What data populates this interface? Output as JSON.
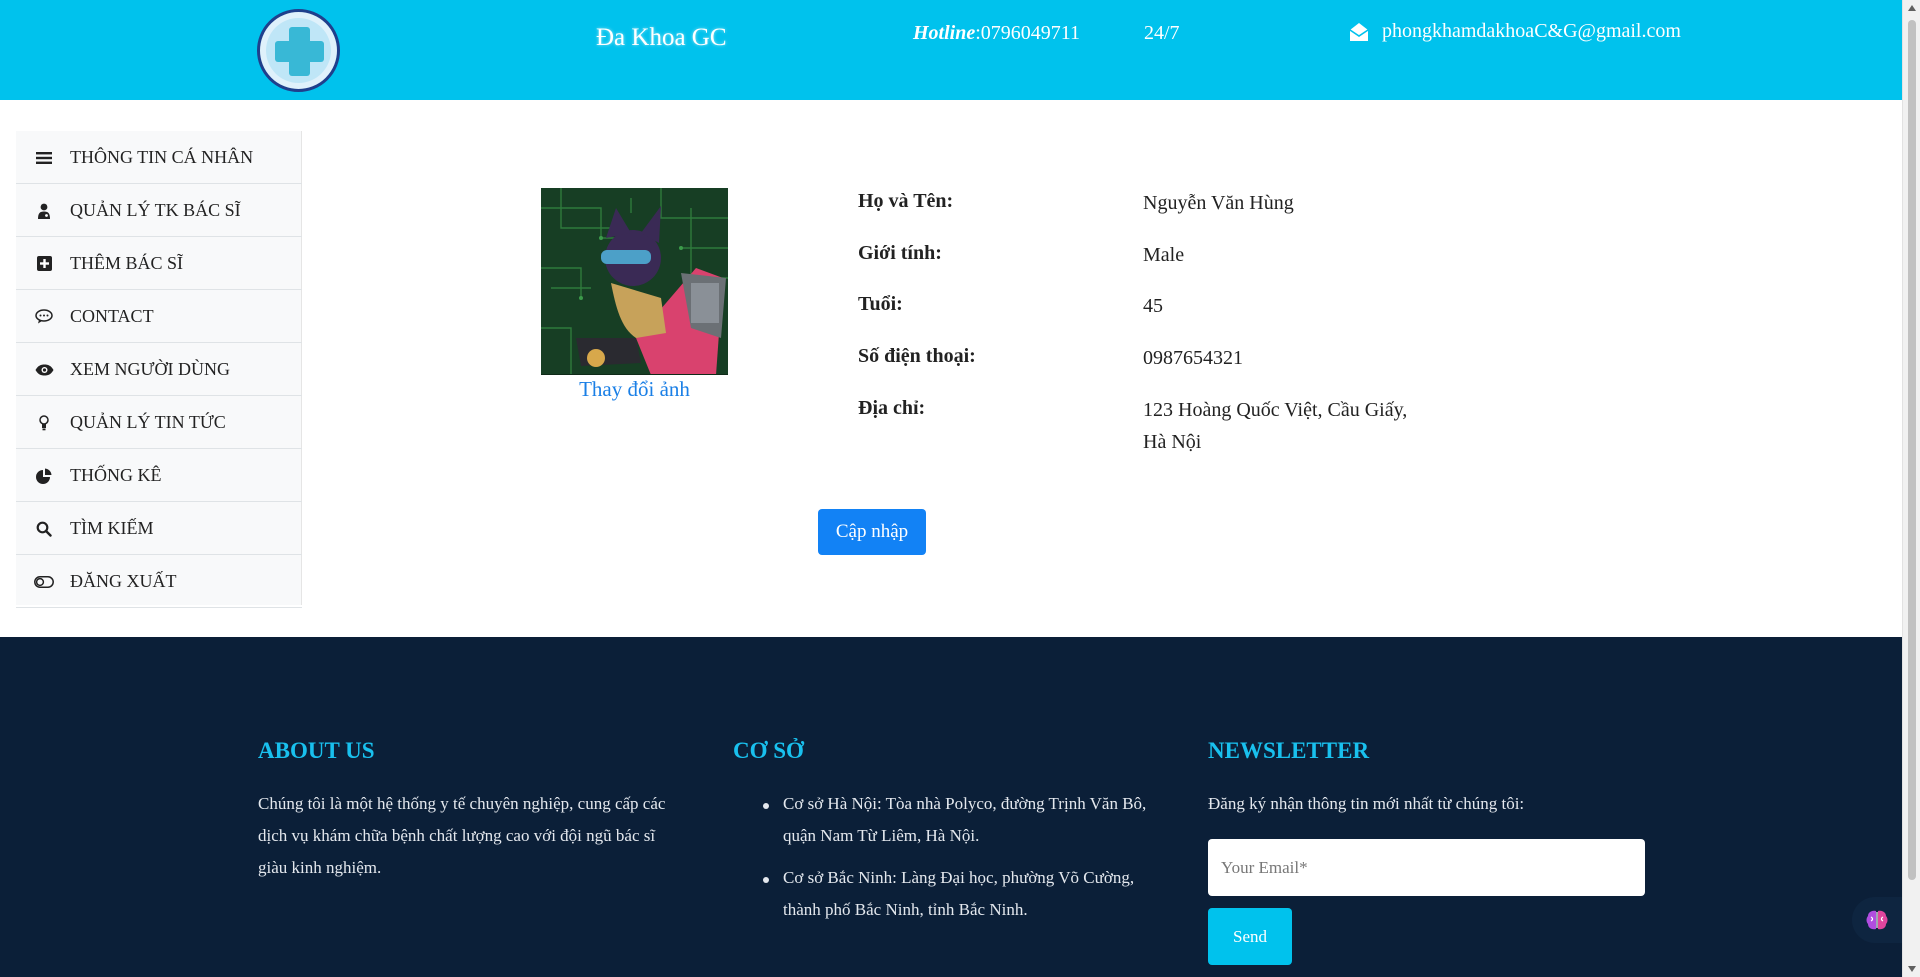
{
  "header": {
    "brand": "Đa Khoa GC",
    "hotline_label": "Hotline",
    "hotline_number": ":0796049711",
    "hours": "24/7",
    "email": "phongkhamdakhoaC&G@gmail.com",
    "colors": {
      "bar": "#00c2ed"
    }
  },
  "sidebar": {
    "items": [
      {
        "label": "THÔNG TIN CÁ NHÂN",
        "icon": "menu-icon"
      },
      {
        "label": "QUẢN LÝ TK BÁC SĨ",
        "icon": "doctor-icon"
      },
      {
        "label": "THÊM BÁC SĨ",
        "icon": "plus-square-icon"
      },
      {
        "label": "CONTACT",
        "icon": "chat-bubble-icon"
      },
      {
        "label": "XEM NGƯỜI DÙNG",
        "icon": "eye-icon"
      },
      {
        "label": "QUẢN LÝ TIN TỨC",
        "icon": "lightbulb-icon"
      },
      {
        "label": "THỐNG KÊ",
        "icon": "pie-chart-icon"
      },
      {
        "label": "TÌM KIẾM",
        "icon": "search-icon"
      },
      {
        "label": "ĐĂNG XUẤT",
        "icon": "toggle-icon"
      }
    ]
  },
  "profile": {
    "change_photo": "Thay đổi ảnh",
    "fields": [
      {
        "label": "Họ và Tên:",
        "value": "Nguyễn Văn Hùng"
      },
      {
        "label": "Giới tính:",
        "value": "Male"
      },
      {
        "label": "Tuổi:",
        "value": "45"
      },
      {
        "label": "Số điện thoại:",
        "value": "0987654321"
      },
      {
        "label": "Địa chỉ:",
        "value": "123 Hoàng Quốc Việt, Cầu Giấy, Hà Nội"
      }
    ],
    "update_button": "Cập nhập"
  },
  "footer": {
    "about": {
      "title": "ABOUT US",
      "text": "Chúng tôi là một hệ thống y tế chuyên nghiệp, cung cấp các dịch vụ khám chữa bệnh chất lượng cao với đội ngũ bác sĩ giàu kinh nghiệm."
    },
    "branches": {
      "title": "CƠ SỞ",
      "items": [
        "Cơ sở Hà Nội: Tòa nhà Polyco, đường Trịnh Văn Bô, quận Nam Từ Liêm, Hà Nội.",
        "Cơ sở Bắc Ninh: Làng Đại học, phường Võ Cường, thành phố Bắc Ninh, tỉnh Bắc Ninh."
      ]
    },
    "newsletter": {
      "title": "NEWSLETTER",
      "text": "Đăng ký nhận thông tin mới nhất từ chúng tôi:",
      "email_placeholder": "Your Email*",
      "send_label": "Send"
    }
  }
}
